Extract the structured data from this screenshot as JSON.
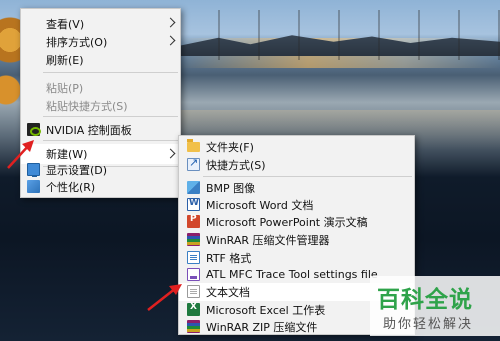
{
  "context_menu": {
    "items": [
      {
        "label": "查看(V)",
        "has_submenu": true,
        "enabled": true
      },
      {
        "label": "排序方式(O)",
        "has_submenu": true,
        "enabled": true
      },
      {
        "label": "刷新(E)",
        "enabled": true
      },
      {
        "label": "粘贴(P)",
        "enabled": false
      },
      {
        "label": "粘贴快捷方式(S)",
        "enabled": false
      },
      {
        "label": "NVIDIA 控制面板",
        "icon": "nvidia-icon",
        "enabled": true
      },
      {
        "label": "新建(W)",
        "has_submenu": true,
        "enabled": true,
        "highlighted": true
      },
      {
        "label": "显示设置(D)",
        "icon": "monitor-icon",
        "enabled": true
      },
      {
        "label": "个性化(R)",
        "icon": "personalize-icon",
        "enabled": true
      }
    ]
  },
  "new_submenu": {
    "items": [
      {
        "label": "文件夹(F)",
        "icon": "folder-icon"
      },
      {
        "label": "快捷方式(S)",
        "icon": "shortcut-icon"
      },
      {
        "label": "BMP 图像",
        "icon": "bmp-image-icon"
      },
      {
        "label": "Microsoft Word 文档",
        "icon": "word-doc-icon"
      },
      {
        "label": "Microsoft PowerPoint 演示文稿",
        "icon": "powerpoint-icon"
      },
      {
        "label": "WinRAR 压缩文件管理器",
        "icon": "winrar-icon"
      },
      {
        "label": "RTF 格式",
        "icon": "rtf-icon"
      },
      {
        "label": "ATL MFC Trace Tool settings file",
        "icon": "atl-trace-icon"
      },
      {
        "label": "文本文档",
        "icon": "text-doc-icon",
        "highlighted": true
      },
      {
        "label": "Microsoft Excel 工作表",
        "icon": "excel-icon"
      },
      {
        "label": "WinRAR ZIP 压缩文件",
        "icon": "winrar-zip-icon"
      }
    ]
  },
  "watermark": {
    "title": "百科全说",
    "subtitle": "助你轻松解决"
  },
  "colors": {
    "menu_bg": "#f2f2f2",
    "highlight_bg": "#ffffff",
    "disabled_text": "#8a8a8a",
    "annotation_arrow": "#e02020",
    "watermark_green": "#2fa34a"
  }
}
